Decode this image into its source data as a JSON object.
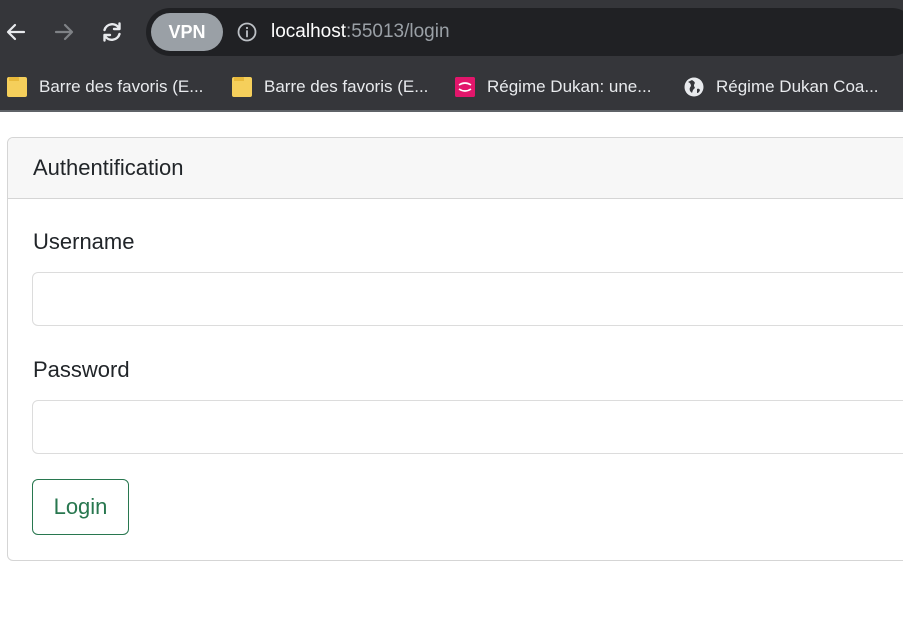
{
  "browser": {
    "nav": {
      "back_icon": "arrow-left-icon",
      "forward_icon": "arrow-right-icon",
      "reload_icon": "reload-icon"
    },
    "vpn_label": "VPN",
    "address": {
      "host": "localhost",
      "rest": ":55013/login"
    },
    "bookmarks": [
      {
        "label": "Barre des favoris (E...",
        "icon": "folder-icon"
      },
      {
        "label": "Barre des favoris (E...",
        "icon": "folder-icon"
      },
      {
        "label": "Régime Dukan: une...",
        "icon": "top-sante-icon"
      },
      {
        "label": "Régime Dukan Coa...",
        "icon": "globe-icon"
      }
    ]
  },
  "card": {
    "title": "Authentification",
    "username_label": "Username",
    "username_value": "",
    "password_label": "Password",
    "password_value": "",
    "login_label": "Login"
  },
  "colors": {
    "chrome_bg": "#35363a",
    "omnibox_bg": "#202124",
    "login_green": "#28774f"
  }
}
